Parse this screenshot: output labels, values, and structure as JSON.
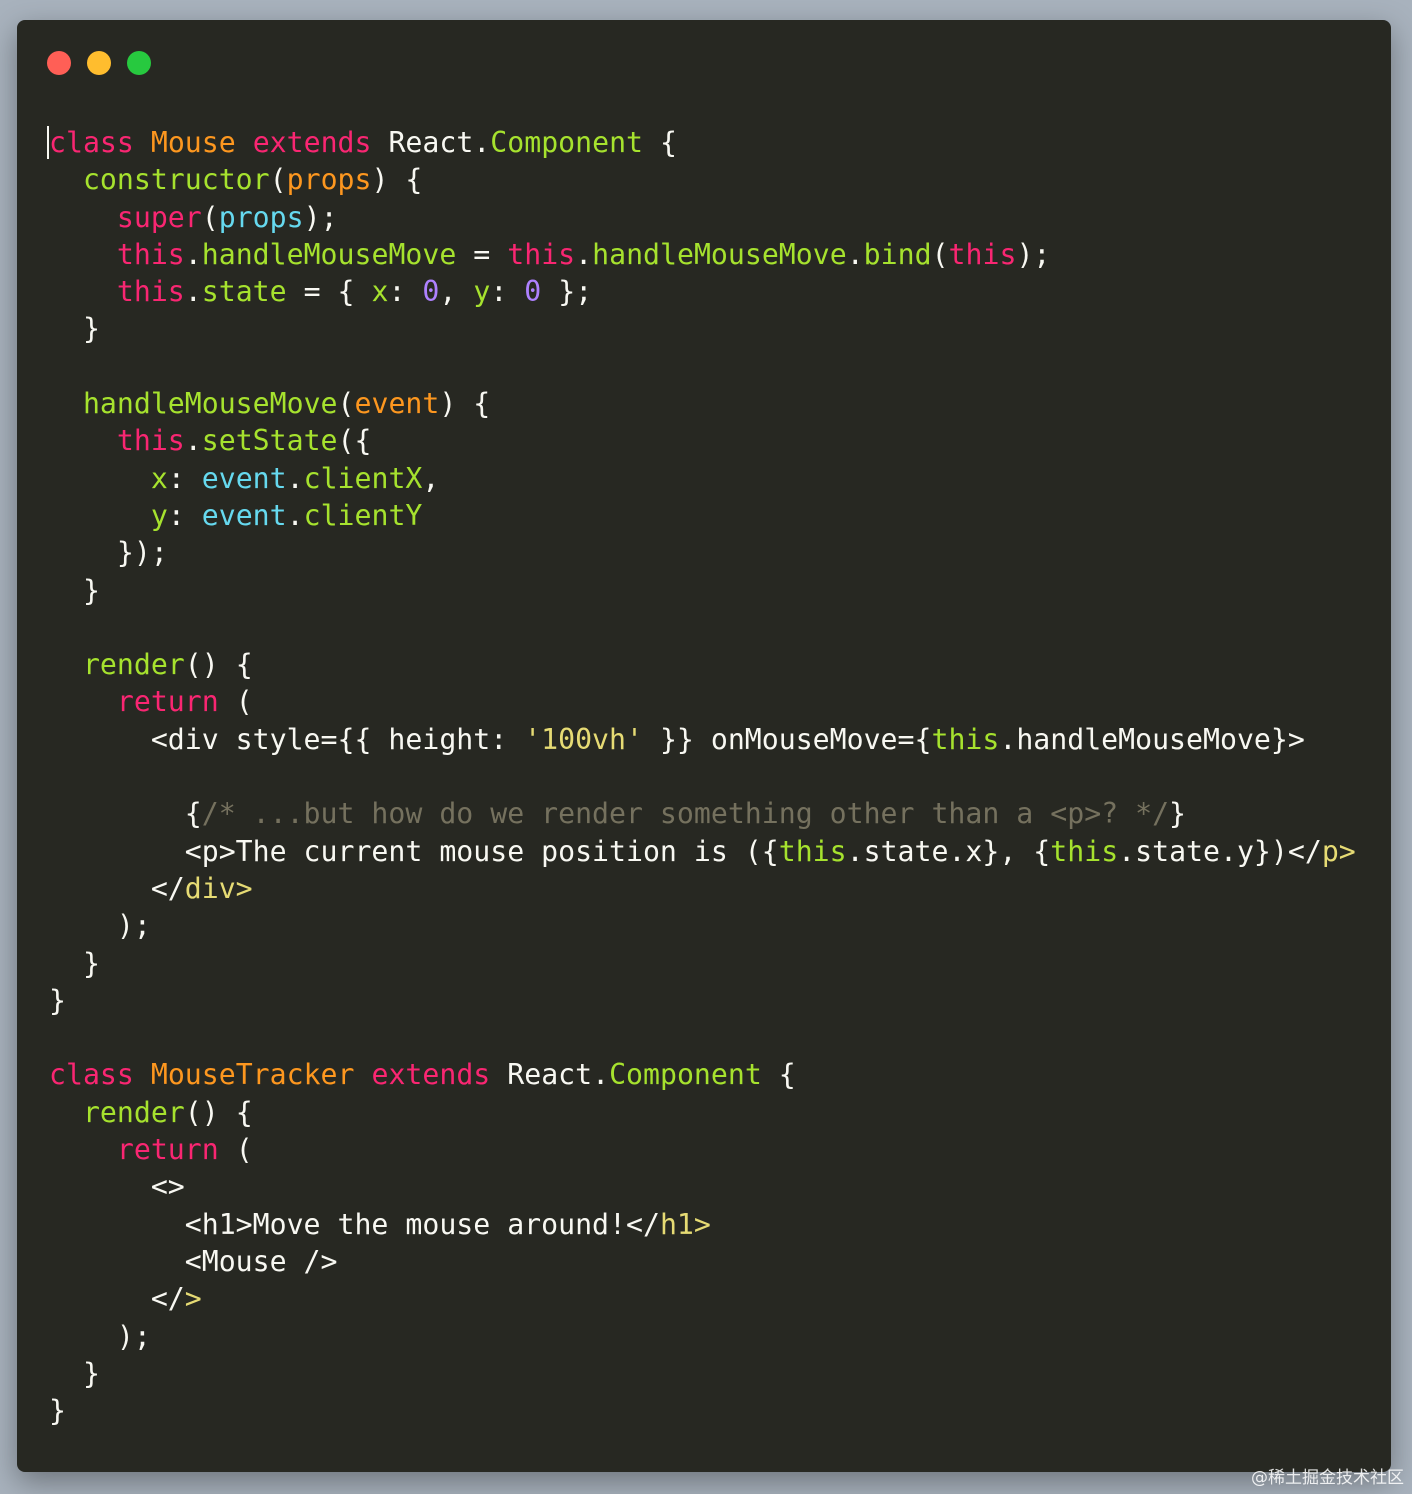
{
  "window": {
    "controls": [
      {
        "name": "close",
        "color": "#ff5f56"
      },
      {
        "name": "minimize",
        "color": "#ffbd2e"
      },
      {
        "name": "maximize",
        "color": "#27c93f"
      }
    ]
  },
  "code": {
    "lines": [
      [
        {
          "t": "class",
          "c": "keyword"
        },
        {
          "t": " "
        },
        {
          "t": "Mouse",
          "c": "class"
        },
        {
          "t": " "
        },
        {
          "t": "extends",
          "c": "keyword"
        },
        {
          "t": " React."
        },
        {
          "t": "Component",
          "c": "func"
        },
        {
          "t": " {"
        }
      ],
      [
        {
          "t": "  "
        },
        {
          "t": "constructor",
          "c": "func"
        },
        {
          "t": "("
        },
        {
          "t": "props",
          "c": "param"
        },
        {
          "t": ") {"
        }
      ],
      [
        {
          "t": "    "
        },
        {
          "t": "super",
          "c": "keyword"
        },
        {
          "t": "("
        },
        {
          "t": "props",
          "c": "member"
        },
        {
          "t": ");"
        }
      ],
      [
        {
          "t": "    "
        },
        {
          "t": "this",
          "c": "keyword"
        },
        {
          "t": "."
        },
        {
          "t": "handleMouseMove",
          "c": "prop"
        },
        {
          "t": " = "
        },
        {
          "t": "this",
          "c": "keyword"
        },
        {
          "t": "."
        },
        {
          "t": "handleMouseMove",
          "c": "prop"
        },
        {
          "t": "."
        },
        {
          "t": "bind",
          "c": "prop"
        },
        {
          "t": "("
        },
        {
          "t": "this",
          "c": "keyword"
        },
        {
          "t": ");"
        }
      ],
      [
        {
          "t": "    "
        },
        {
          "t": "this",
          "c": "keyword"
        },
        {
          "t": "."
        },
        {
          "t": "state",
          "c": "prop"
        },
        {
          "t": " = { "
        },
        {
          "t": "x",
          "c": "prop"
        },
        {
          "t": ": "
        },
        {
          "t": "0",
          "c": "number"
        },
        {
          "t": ", "
        },
        {
          "t": "y",
          "c": "prop"
        },
        {
          "t": ": "
        },
        {
          "t": "0",
          "c": "number"
        },
        {
          "t": " };"
        }
      ],
      [
        {
          "t": "  }"
        }
      ],
      [
        {
          "t": ""
        }
      ],
      [
        {
          "t": "  "
        },
        {
          "t": "handleMouseMove",
          "c": "func"
        },
        {
          "t": "("
        },
        {
          "t": "event",
          "c": "param"
        },
        {
          "t": ") {"
        }
      ],
      [
        {
          "t": "    "
        },
        {
          "t": "this",
          "c": "keyword"
        },
        {
          "t": "."
        },
        {
          "t": "setState",
          "c": "prop"
        },
        {
          "t": "({"
        }
      ],
      [
        {
          "t": "      "
        },
        {
          "t": "x",
          "c": "prop"
        },
        {
          "t": ": "
        },
        {
          "t": "event",
          "c": "member"
        },
        {
          "t": "."
        },
        {
          "t": "clientX",
          "c": "prop"
        },
        {
          "t": ","
        }
      ],
      [
        {
          "t": "      "
        },
        {
          "t": "y",
          "c": "prop"
        },
        {
          "t": ": "
        },
        {
          "t": "event",
          "c": "member"
        },
        {
          "t": "."
        },
        {
          "t": "clientY",
          "c": "prop"
        }
      ],
      [
        {
          "t": "    });"
        }
      ],
      [
        {
          "t": "  }"
        }
      ],
      [
        {
          "t": ""
        }
      ],
      [
        {
          "t": "  "
        },
        {
          "t": "render",
          "c": "func"
        },
        {
          "t": "() {"
        }
      ],
      [
        {
          "t": "    "
        },
        {
          "t": "return",
          "c": "keyword"
        },
        {
          "t": " ("
        }
      ],
      [
        {
          "t": "      <div style={{ height: "
        },
        {
          "t": "'100vh'",
          "c": "string"
        },
        {
          "t": " }} onMouseMove={"
        },
        {
          "t": "this",
          "c": "prop"
        },
        {
          "t": ".handleMouseMove}>"
        }
      ],
      [
        {
          "t": ""
        }
      ],
      [
        {
          "t": "        {"
        },
        {
          "t": "/* ...but how do we render something other than a <p>? */",
          "c": "comment"
        },
        {
          "t": "}"
        }
      ],
      [
        {
          "t": "        <p>The current mouse position is ({"
        },
        {
          "t": "this",
          "c": "prop"
        },
        {
          "t": ".state.x}, {"
        },
        {
          "t": "this",
          "c": "prop"
        },
        {
          "t": ".state.y})</"
        },
        {
          "t": "p>",
          "c": "string"
        }
      ],
      [
        {
          "t": "      </"
        },
        {
          "t": "div>",
          "c": "string"
        }
      ],
      [
        {
          "t": "    );"
        }
      ],
      [
        {
          "t": "  }"
        }
      ],
      [
        {
          "t": "}"
        }
      ],
      [
        {
          "t": ""
        }
      ],
      [
        {
          "t": "class",
          "c": "keyword"
        },
        {
          "t": " "
        },
        {
          "t": "MouseTracker",
          "c": "class"
        },
        {
          "t": " "
        },
        {
          "t": "extends",
          "c": "keyword"
        },
        {
          "t": " React."
        },
        {
          "t": "Component",
          "c": "func"
        },
        {
          "t": " {"
        }
      ],
      [
        {
          "t": "  "
        },
        {
          "t": "render",
          "c": "func"
        },
        {
          "t": "() {"
        }
      ],
      [
        {
          "t": "    "
        },
        {
          "t": "return",
          "c": "keyword"
        },
        {
          "t": " ("
        }
      ],
      [
        {
          "t": "      <>"
        }
      ],
      [
        {
          "t": "        <h1>Move the mouse around!</"
        },
        {
          "t": "h1>",
          "c": "string"
        }
      ],
      [
        {
          "t": "        <Mouse />"
        }
      ],
      [
        {
          "t": "      </"
        },
        {
          "t": ">",
          "c": "string"
        }
      ],
      [
        {
          "t": "    );"
        }
      ],
      [
        {
          "t": "  }"
        }
      ],
      [
        {
          "t": "}"
        }
      ]
    ]
  },
  "watermark": "@稀土掘金技术社区"
}
